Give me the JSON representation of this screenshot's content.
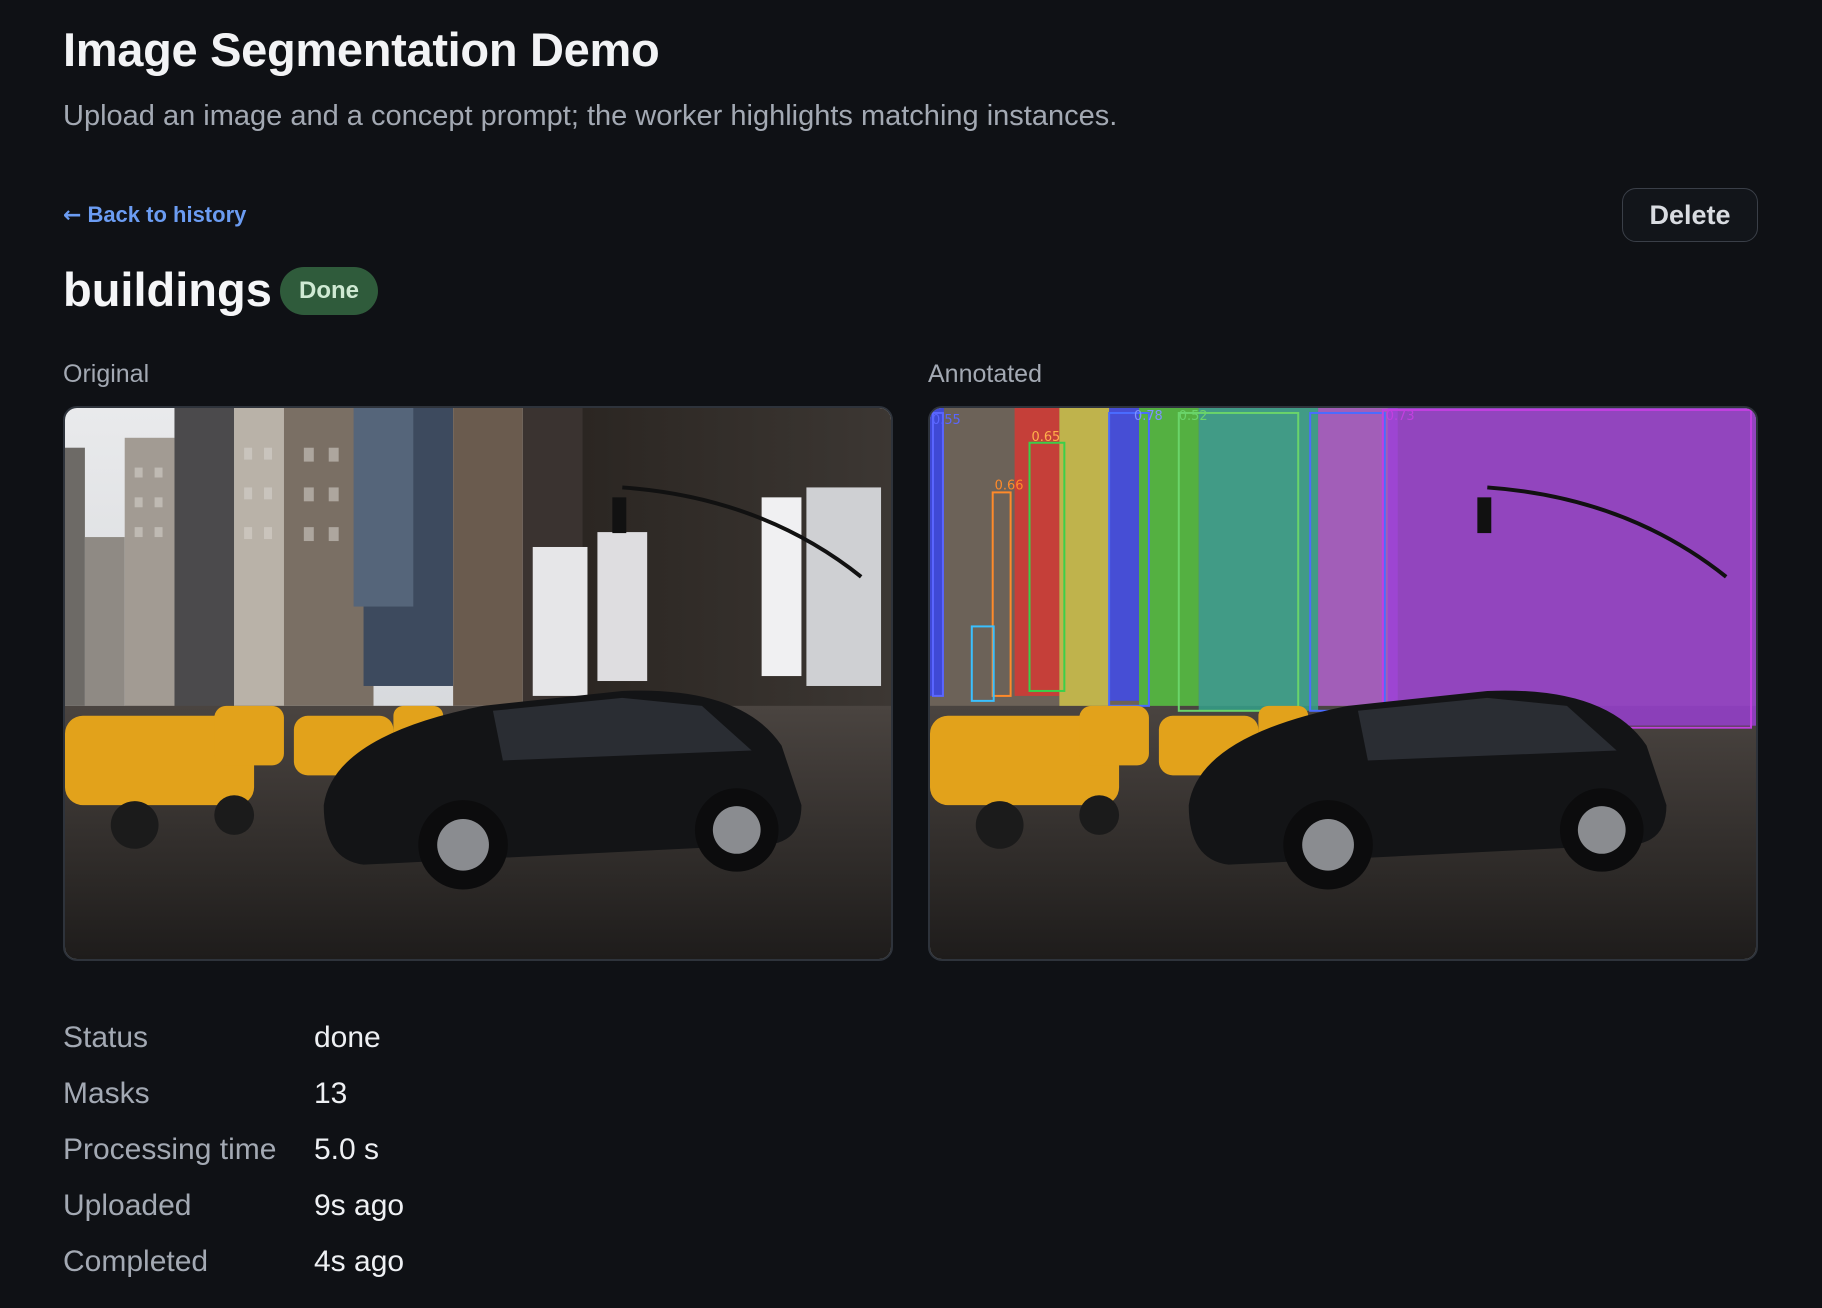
{
  "app": {
    "title": "Image Segmentation Demo",
    "subtitle": "Upload an image and a concept prompt; the worker highlights matching instances."
  },
  "nav": {
    "back_label": "Back to history",
    "back_icon": "arrow-left-icon"
  },
  "actions": {
    "delete_label": "Delete"
  },
  "job": {
    "prompt": "buildings",
    "status_badge": "Done"
  },
  "panels": {
    "original_label": "Original",
    "annotated_label": "Annotated"
  },
  "annotations": [
    {
      "score": "0.55",
      "color": "#3b5bff"
    },
    {
      "score": "0.66",
      "color": "#ff8a2a"
    },
    {
      "score": "0.65",
      "color": "#3ad04a"
    },
    {
      "score": "0.78",
      "color": "#4a6cff"
    },
    {
      "score": "0.52",
      "color": "#6ad46a"
    },
    {
      "score": "0.73",
      "color": "#c23fe0"
    }
  ],
  "details": [
    {
      "key": "Status",
      "value": "done"
    },
    {
      "key": "Masks",
      "value": "13"
    },
    {
      "key": "Processing time",
      "value": "5.0 s"
    },
    {
      "key": "Uploaded",
      "value": "9s ago"
    },
    {
      "key": "Completed",
      "value": "4s ago"
    }
  ],
  "colors": {
    "background": "#0f1115",
    "accent_link": "#6b9cf2",
    "badge_bg": "#2f5b3b",
    "badge_text": "#cfe9d3"
  }
}
